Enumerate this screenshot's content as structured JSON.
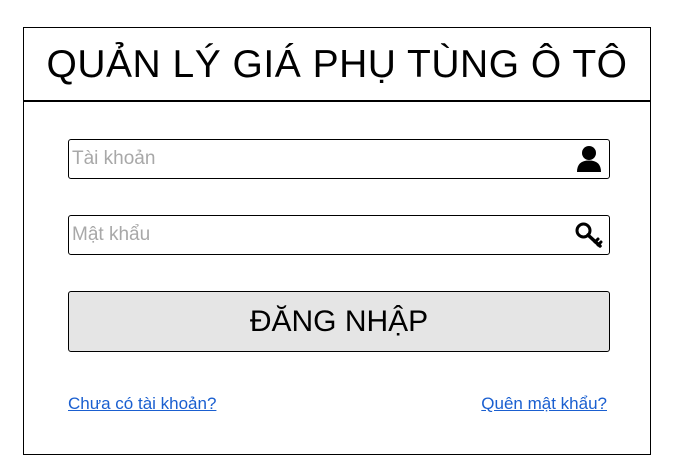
{
  "header": {
    "title": "QUẢN LÝ GIÁ PHỤ TÙNG Ô TÔ"
  },
  "form": {
    "username": {
      "placeholder": "Tài khoản",
      "value": "",
      "icon": "user-icon"
    },
    "password": {
      "placeholder": "Mật khẩu",
      "value": "",
      "icon": "key-icon"
    },
    "login_label": "ĐĂNG NHẬP"
  },
  "links": {
    "register": "Chưa có tài khoản?",
    "forgot_password": "Quên mật khẩu?"
  },
  "colors": {
    "link": "#1a5fd0",
    "button_bg": "#e5e5e5",
    "border": "#000000",
    "placeholder": "#a8a8a8"
  }
}
